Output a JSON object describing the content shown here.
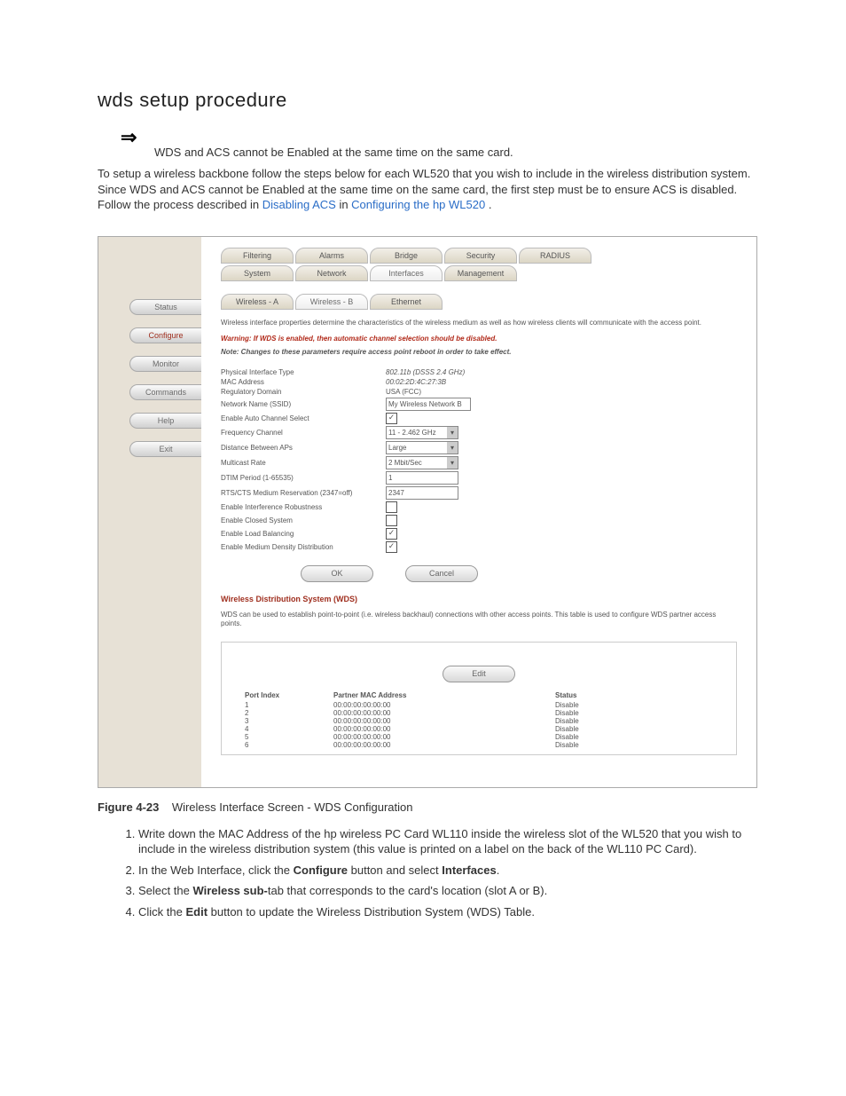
{
  "title": "wds setup procedure",
  "arrow_note": "WDS and ACS cannot be Enabled at the same time on the same card.",
  "intro_1": "To setup a wireless backbone follow the steps below for each WL520 that you wish to include in the wireless distribution system. Since WDS and ACS cannot be Enabled at the same time on the same card, the first step must be to ensure ACS is disabled. Follow the process described in ",
  "intro_link1": "Disabling ACS",
  "intro_mid": " in ",
  "intro_link2": "Configuring the hp WL520",
  "intro_end": ".",
  "sidebar": [
    "Status",
    "Configure",
    "Monitor",
    "Commands",
    "Help",
    "Exit"
  ],
  "sidebar_sel": 1,
  "tabrow1": [
    "Filtering",
    "Alarms",
    "Bridge",
    "Security",
    "RADIUS"
  ],
  "tabrow2": [
    "System",
    "Network",
    "Interfaces",
    "Management"
  ],
  "tabrow2_sel": 2,
  "tabrow3": [
    "Wireless - A",
    "Wireless - B",
    "Ethernet"
  ],
  "tabrow3_sel": 1,
  "info_text": "Wireless interface properties determine the characteristics of the wireless medium as well as how wireless clients will communicate with the access point.",
  "warn_text": "Warning: If WDS is enabled, then automatic channel selection should be disabled.",
  "note_text": "Note: Changes to these parameters require access point reboot in order to take effect.",
  "fields": {
    "phys_lab": "Physical Interface Type",
    "phys_val": "802.11b (DSSS 2.4 GHz)",
    "mac_lab": "MAC Address",
    "mac_val": "00:02:2D:4C:27:3B",
    "reg_lab": "Regulatory Domain",
    "reg_val": "USA (FCC)",
    "ssid_lab": "Network Name (SSID)",
    "ssid_val": "My Wireless Network B",
    "acs_lab": "Enable Auto Channel Select",
    "acs_val": "✓",
    "freq_lab": "Frequency Channel",
    "freq_val": "11 - 2.462 GHz",
    "dist_lab": "Distance Between APs",
    "dist_val": "Large",
    "multi_lab": "Multicast Rate",
    "multi_val": "2 Mbit/Sec",
    "dtim_lab": "DTIM Period (1-65535)",
    "dtim_val": "1",
    "rts_lab": "RTS/CTS Medium Reservation (2347=off)",
    "rts_val": "2347",
    "intf_lab": "Enable Interference Robustness",
    "intf_val": "",
    "closed_lab": "Enable Closed System",
    "closed_val": "",
    "lb_lab": "Enable Load Balancing",
    "lb_val": "✓",
    "mdd_lab": "Enable Medium Density Distribution",
    "mdd_val": "✓"
  },
  "ok_label": "OK",
  "cancel_label": "Cancel",
  "wds_heading": "Wireless Distribution System (WDS)",
  "wds_desc": "WDS can be used to establish point-to-point (i.e. wireless backhaul) connections with other access points. This table is used to configure WDS partner access points.",
  "edit_label": "Edit",
  "wds_headers": [
    "Port Index",
    "Partner MAC Address",
    "Status"
  ],
  "wds_rows": [
    {
      "idx": "1",
      "mac": "00:00:00:00:00:00",
      "st": "Disable"
    },
    {
      "idx": "2",
      "mac": "00:00:00:00:00:00",
      "st": "Disable"
    },
    {
      "idx": "3",
      "mac": "00:00:00:00:00:00",
      "st": "Disable"
    },
    {
      "idx": "4",
      "mac": "00:00:00:00:00:00",
      "st": "Disable"
    },
    {
      "idx": "5",
      "mac": "00:00:00:00:00:00",
      "st": "Disable"
    },
    {
      "idx": "6",
      "mac": "00:00:00:00:00:00",
      "st": "Disable"
    }
  ],
  "figure_num": "Figure 4-23",
  "figure_cap": "Wireless Interface Screen - WDS Configuration",
  "steps": {
    "s1": "Write down the MAC Address of the hp  wireless PC Card WL110 inside the wireless slot of the WL520 that you wish to include in the wireless distribution system (this value is printed on a label on the back of the WL110 PC Card).",
    "s2a": "In the Web Interface, click the ",
    "s2b": "Configure",
    "s2c": " button and select ",
    "s2d": "Interfaces",
    "s2e": ".",
    "s3a": "Select the ",
    "s3b": "Wireless sub-",
    "s3c": "tab that corresponds to the card's location (slot A or B).",
    "s4a": "Click the ",
    "s4b": "Edit",
    "s4c": " button to update the Wireless Distribution System (WDS) Table."
  }
}
